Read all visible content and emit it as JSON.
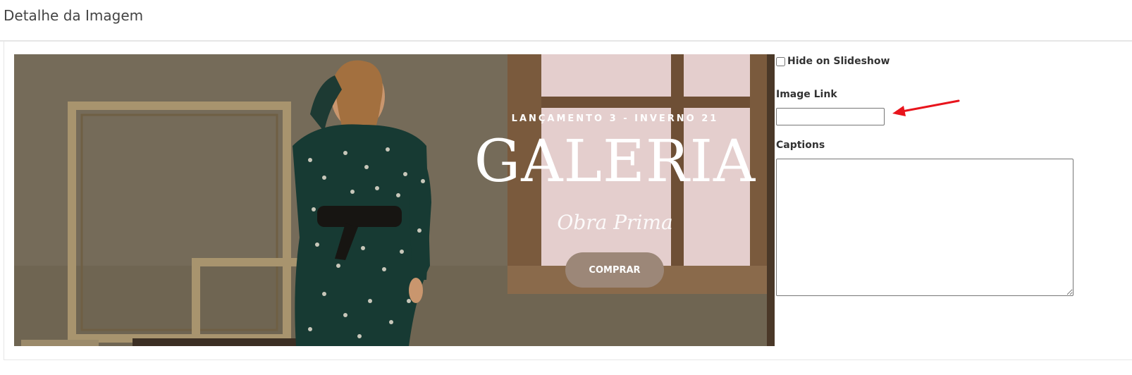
{
  "page": {
    "title": "Detalhe da Imagem"
  },
  "banner": {
    "subtitle": "LANÇAMENTO 3 - INVERNO 21",
    "title": "GALERIA",
    "script": "Obra Prima",
    "cta_label": "COMPRAR"
  },
  "form": {
    "hide_slideshow_label": "Hide on Slideshow",
    "hide_slideshow_checked": false,
    "image_link_label": "Image Link",
    "image_link_value": "",
    "captions_label": "Captions",
    "captions_value": ""
  },
  "colors": {
    "annotation_arrow": "#e8141c",
    "cta_background": "#9c8778"
  }
}
